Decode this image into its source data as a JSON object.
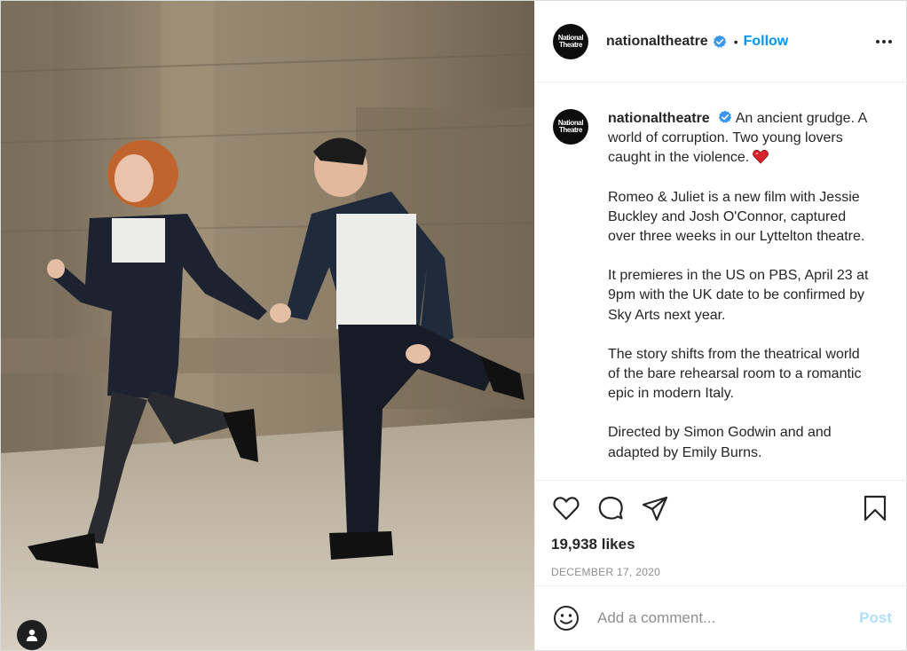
{
  "account": {
    "username": "nationaltheatre",
    "avatar_text_line1": "National",
    "avatar_text_line2": "Theatre",
    "verified_icon": "verified-badge-icon",
    "follow_label": "Follow",
    "separator": "•"
  },
  "caption": {
    "username": "nationaltheatre",
    "intro": "An ancient grudge. A world of corruption. Two young lovers caught in the violence.",
    "paragraphs": [
      "Romeo & Juliet is a new film with Jessie Buckley and Josh O'Connor, captured over three weeks in our Lyttelton theatre.",
      "It premieres in the US on PBS, April 23 at 9pm with the UK date to be confirmed by Sky Arts next year.",
      "The story shifts from the theatrical world of the bare rehearsal room to a romantic epic in modern Italy.",
      "Directed by Simon Godwin and and adapted by Emily Burns."
    ]
  },
  "actions": {
    "like_icon": "heart-icon",
    "comment_icon": "comment-icon",
    "share_icon": "paper-plane-icon",
    "save_icon": "bookmark-icon"
  },
  "stats": {
    "likes": "19,938 likes",
    "date": "DECEMBER 17, 2020"
  },
  "comment": {
    "placeholder": "Add a comment...",
    "post_label": "Post"
  },
  "colors": {
    "accent": "#0095f6",
    "post_disabled": "#b2dffc",
    "text": "#262626",
    "muted": "#8e8e8e",
    "heart_emoji": "#d8232a"
  }
}
